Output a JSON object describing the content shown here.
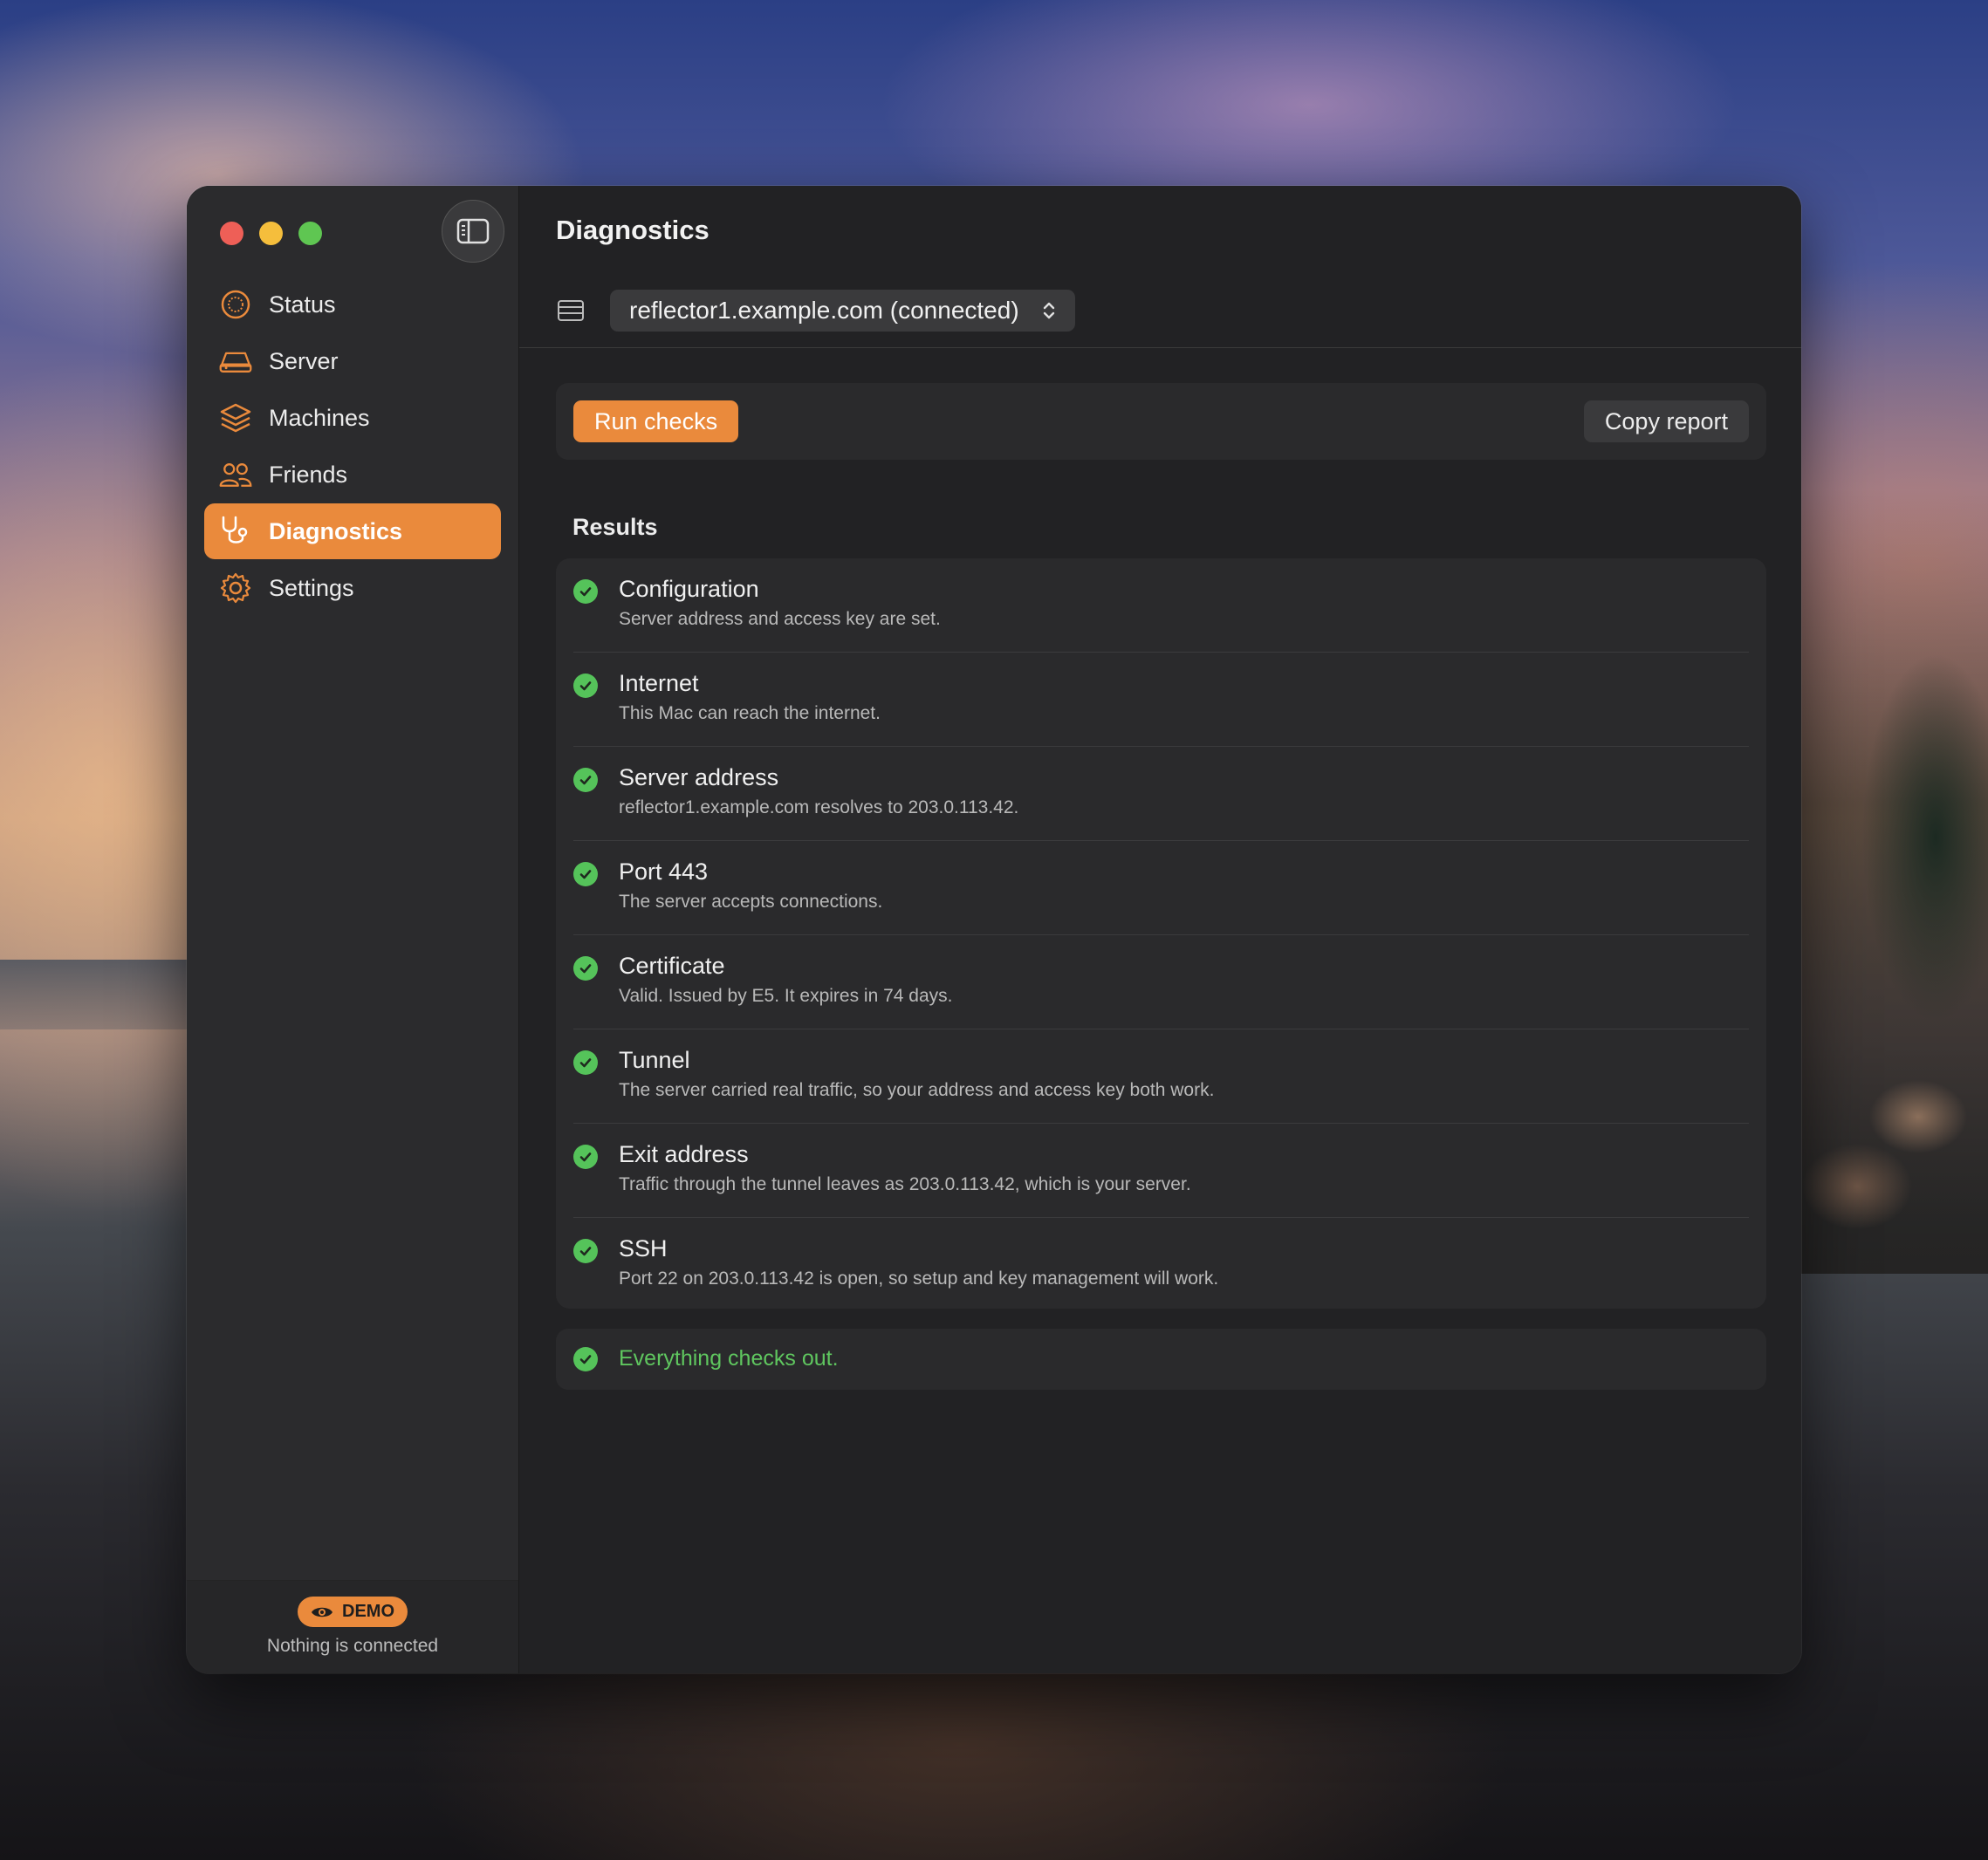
{
  "sidebar": {
    "items": [
      {
        "label": "Status",
        "icon": "status-icon"
      },
      {
        "label": "Server",
        "icon": "server-icon"
      },
      {
        "label": "Machines",
        "icon": "layers-icon"
      },
      {
        "label": "Friends",
        "icon": "friends-icon"
      },
      {
        "label": "Diagnostics",
        "icon": "stethoscope-icon",
        "active": true
      },
      {
        "label": "Settings",
        "icon": "gear-icon"
      }
    ],
    "footer": {
      "badge": "DEMO",
      "status": "Nothing is connected"
    }
  },
  "main": {
    "title": "Diagnostics",
    "server_select": "reflector1.example.com (connected)",
    "run_label": "Run checks",
    "copy_label": "Copy report",
    "results_heading": "Results",
    "results": [
      {
        "title": "Configuration",
        "desc": "Server address and access key are set.",
        "status": "pass"
      },
      {
        "title": "Internet",
        "desc": "This Mac can reach the internet.",
        "status": "pass"
      },
      {
        "title": "Server address",
        "desc": "reflector1.example.com resolves to 203.0.113.42.",
        "status": "pass"
      },
      {
        "title": "Port 443",
        "desc": "The server accepts connections.",
        "status": "pass"
      },
      {
        "title": "Certificate",
        "desc": "Valid. Issued by E5. It expires in 74 days.",
        "status": "pass"
      },
      {
        "title": "Tunnel",
        "desc": "The server carried real traffic, so your address and access key both work.",
        "status": "pass"
      },
      {
        "title": "Exit address",
        "desc": "Traffic through the tunnel leaves as 203.0.113.42, which is your server.",
        "status": "pass"
      },
      {
        "title": "SSH",
        "desc": "Port 22 on 203.0.113.42 is open, so setup and key management will work.",
        "status": "pass"
      }
    ],
    "summary": "Everything checks out."
  },
  "colors": {
    "accent": "#ea8a3c",
    "success": "#55c35a"
  }
}
